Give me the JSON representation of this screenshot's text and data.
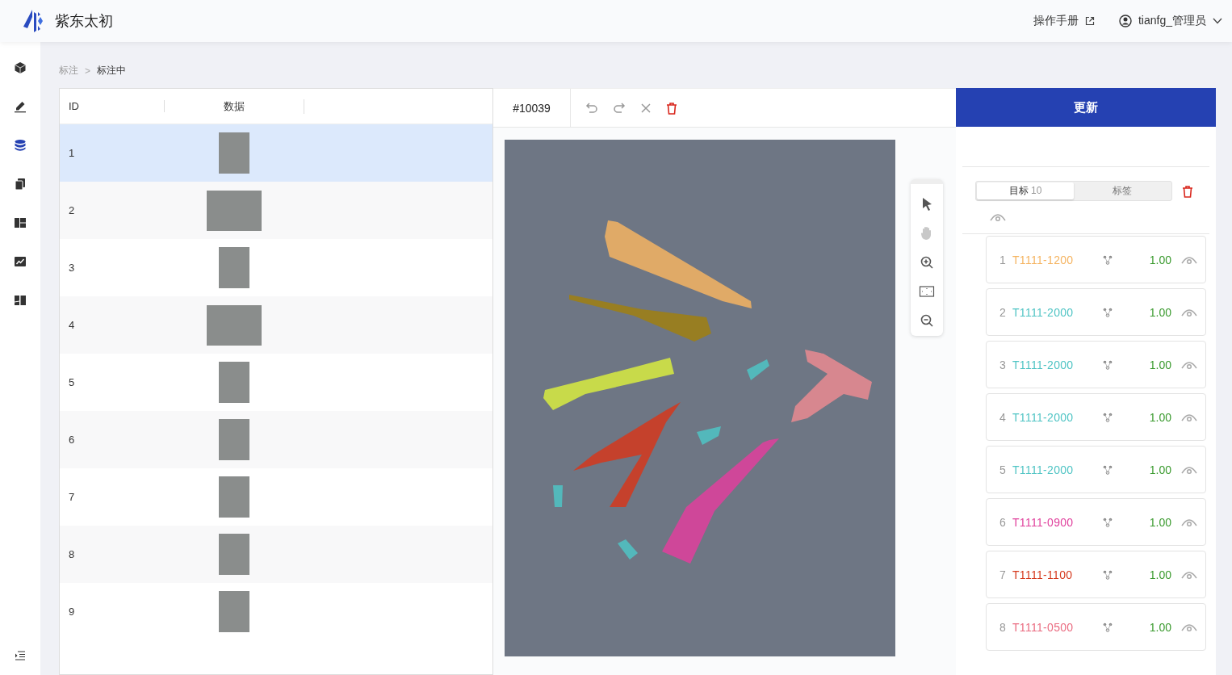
{
  "header": {
    "brand": "紫东太初",
    "manual_link": "操作手册",
    "user": "tianfg_管理员"
  },
  "sidebar": {
    "items": [
      {
        "selected": false
      },
      {
        "selected": false
      },
      {
        "selected": true
      },
      {
        "selected": false
      },
      {
        "selected": false
      },
      {
        "selected": false
      },
      {
        "selected": false
      }
    ]
  },
  "breadcrumb": {
    "separator": ">",
    "items": [
      {
        "label": "标注",
        "current": false
      },
      {
        "label": "标注中",
        "current": true
      }
    ]
  },
  "table": {
    "columns": [
      "ID",
      "数据"
    ],
    "rows": [
      {
        "id": "1",
        "selected": true,
        "wide": false
      },
      {
        "id": "2",
        "selected": false,
        "wide": true
      },
      {
        "id": "3",
        "selected": false,
        "wide": false
      },
      {
        "id": "4",
        "selected": false,
        "wide": true
      },
      {
        "id": "5",
        "selected": false,
        "wide": false
      },
      {
        "id": "6",
        "selected": false,
        "wide": false
      },
      {
        "id": "7",
        "selected": false,
        "wide": false
      },
      {
        "id": "8",
        "selected": false,
        "wide": false
      },
      {
        "id": "9",
        "selected": false,
        "wide": false
      }
    ]
  },
  "editor": {
    "item_id": "#10039",
    "tools": [
      {
        "kind": "pointer",
        "disabled": false
      },
      {
        "kind": "hand",
        "disabled": true
      },
      {
        "kind": "zoom-in",
        "disabled": false
      },
      {
        "kind": "fit",
        "disabled": false
      },
      {
        "kind": "zoom-out",
        "disabled": false
      }
    ]
  },
  "panel": {
    "update_button": "更新",
    "tabs": [
      {
        "label": "目标",
        "count": "10",
        "selected": true
      },
      {
        "label": "标签",
        "selected": false
      }
    ],
    "objects": [
      {
        "index": "1",
        "label": "T1111-1200",
        "color": "#f5b461",
        "score": "1.00"
      },
      {
        "index": "2",
        "label": "T1111-2000",
        "color": "#4fc4c4",
        "score": "1.00"
      },
      {
        "index": "3",
        "label": "T1111-2000",
        "color": "#4fc4c4",
        "score": "1.00"
      },
      {
        "index": "4",
        "label": "T1111-2000",
        "color": "#4fc4c4",
        "score": "1.00"
      },
      {
        "index": "5",
        "label": "T1111-2000",
        "color": "#4fc4c4",
        "score": "1.00"
      },
      {
        "index": "6",
        "label": "T1111-0900",
        "color": "#e0409c",
        "score": "1.00"
      },
      {
        "index": "7",
        "label": "T1111-1100",
        "color": "#d5381c",
        "score": "1.00"
      },
      {
        "index": "8",
        "label": "T1111-0500",
        "color": "#ea6b80",
        "score": "1.00"
      }
    ]
  }
}
